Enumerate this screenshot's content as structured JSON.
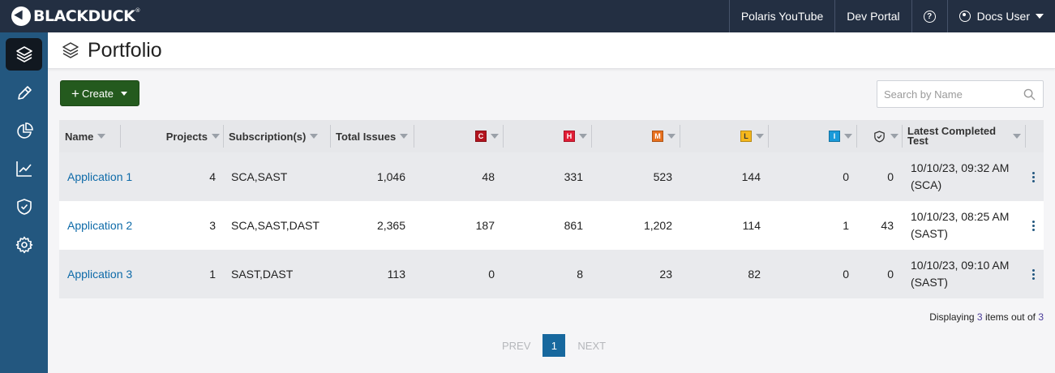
{
  "brand": {
    "name": "BLACKDUCK",
    "mark": "®"
  },
  "topnav": {
    "links": [
      "Polaris YouTube",
      "Dev Portal"
    ],
    "help_symbol": "?",
    "user": "Docs User"
  },
  "sidebar": {
    "items": [
      {
        "icon": "portfolio-layers-icon",
        "active": true
      },
      {
        "icon": "pen-icon",
        "active": false
      },
      {
        "icon": "pie-chart-icon",
        "active": false
      },
      {
        "icon": "trend-chart-icon",
        "active": false
      },
      {
        "icon": "shield-check-icon",
        "active": false
      },
      {
        "icon": "gear-icon",
        "active": false
      }
    ]
  },
  "page": {
    "title": "Portfolio"
  },
  "toolbar": {
    "create_label": "Create",
    "create_plus": "+"
  },
  "search": {
    "placeholder": "Search by Name",
    "value": ""
  },
  "colors": {
    "critical": "#b3141e",
    "high": "#e11d35",
    "medium": "#e8701e",
    "low": "#f5b71c",
    "info": "#1a9ad9",
    "brand_green": "#245a1e",
    "sidebar": "#23577f",
    "topbar": "#232f42"
  },
  "table": {
    "columns": {
      "name": "Name",
      "projects": "Projects",
      "subscriptions": "Subscription(s)",
      "total": "Total Issues",
      "critical": "C",
      "high": "H",
      "medium": "M",
      "low": "L",
      "info": "I",
      "latest": "Latest Completed Test"
    },
    "rows": [
      {
        "name": "Application 1",
        "projects": "4",
        "subscriptions": "SCA,SAST",
        "total": "1,046",
        "critical": "48",
        "high": "331",
        "medium": "523",
        "low": "144",
        "info": "0",
        "policy": "0",
        "test_date": "10/10/23, 09:32 AM",
        "test_type": "(SCA)"
      },
      {
        "name": "Application 2",
        "projects": "3",
        "subscriptions": "SCA,SAST,DAST",
        "total": "2,365",
        "critical": "187",
        "high": "861",
        "medium": "1,202",
        "low": "114",
        "info": "1",
        "policy": "43",
        "test_date": "10/10/23, 08:25 AM",
        "test_type": "(SAST)"
      },
      {
        "name": "Application 3",
        "projects": "1",
        "subscriptions": "SAST,DAST",
        "total": "113",
        "critical": "0",
        "high": "8",
        "medium": "23",
        "low": "82",
        "info": "0",
        "policy": "0",
        "test_date": "10/10/23, 09:10 AM",
        "test_type": "(SAST)"
      }
    ]
  },
  "footer": {
    "prefix": "Displaying",
    "shown": "3",
    "middle": "items out of",
    "total": "3"
  },
  "pagination": {
    "prev": "PREV",
    "current": "1",
    "next": "NEXT"
  }
}
